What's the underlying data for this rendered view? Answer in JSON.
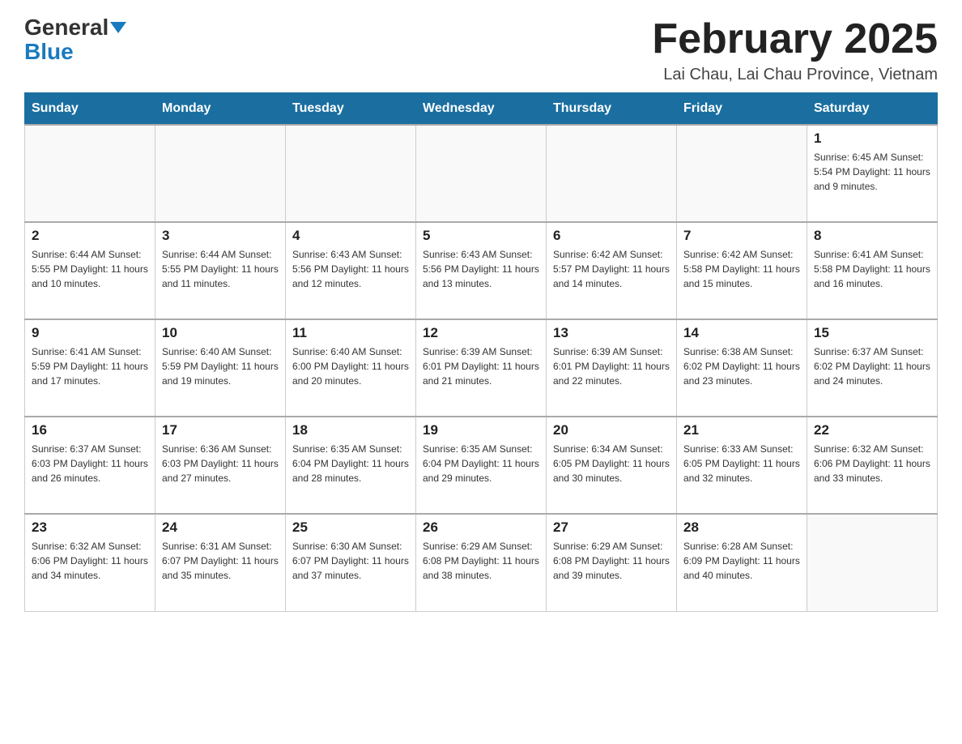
{
  "header": {
    "logo_general": "General",
    "logo_blue": "Blue",
    "month_title": "February 2025",
    "location": "Lai Chau, Lai Chau Province, Vietnam"
  },
  "days_of_week": [
    "Sunday",
    "Monday",
    "Tuesday",
    "Wednesday",
    "Thursday",
    "Friday",
    "Saturday"
  ],
  "weeks": [
    [
      {
        "day": "",
        "info": ""
      },
      {
        "day": "",
        "info": ""
      },
      {
        "day": "",
        "info": ""
      },
      {
        "day": "",
        "info": ""
      },
      {
        "day": "",
        "info": ""
      },
      {
        "day": "",
        "info": ""
      },
      {
        "day": "1",
        "info": "Sunrise: 6:45 AM\nSunset: 5:54 PM\nDaylight: 11 hours and 9 minutes."
      }
    ],
    [
      {
        "day": "2",
        "info": "Sunrise: 6:44 AM\nSunset: 5:55 PM\nDaylight: 11 hours and 10 minutes."
      },
      {
        "day": "3",
        "info": "Sunrise: 6:44 AM\nSunset: 5:55 PM\nDaylight: 11 hours and 11 minutes."
      },
      {
        "day": "4",
        "info": "Sunrise: 6:43 AM\nSunset: 5:56 PM\nDaylight: 11 hours and 12 minutes."
      },
      {
        "day": "5",
        "info": "Sunrise: 6:43 AM\nSunset: 5:56 PM\nDaylight: 11 hours and 13 minutes."
      },
      {
        "day": "6",
        "info": "Sunrise: 6:42 AM\nSunset: 5:57 PM\nDaylight: 11 hours and 14 minutes."
      },
      {
        "day": "7",
        "info": "Sunrise: 6:42 AM\nSunset: 5:58 PM\nDaylight: 11 hours and 15 minutes."
      },
      {
        "day": "8",
        "info": "Sunrise: 6:41 AM\nSunset: 5:58 PM\nDaylight: 11 hours and 16 minutes."
      }
    ],
    [
      {
        "day": "9",
        "info": "Sunrise: 6:41 AM\nSunset: 5:59 PM\nDaylight: 11 hours and 17 minutes."
      },
      {
        "day": "10",
        "info": "Sunrise: 6:40 AM\nSunset: 5:59 PM\nDaylight: 11 hours and 19 minutes."
      },
      {
        "day": "11",
        "info": "Sunrise: 6:40 AM\nSunset: 6:00 PM\nDaylight: 11 hours and 20 minutes."
      },
      {
        "day": "12",
        "info": "Sunrise: 6:39 AM\nSunset: 6:01 PM\nDaylight: 11 hours and 21 minutes."
      },
      {
        "day": "13",
        "info": "Sunrise: 6:39 AM\nSunset: 6:01 PM\nDaylight: 11 hours and 22 minutes."
      },
      {
        "day": "14",
        "info": "Sunrise: 6:38 AM\nSunset: 6:02 PM\nDaylight: 11 hours and 23 minutes."
      },
      {
        "day": "15",
        "info": "Sunrise: 6:37 AM\nSunset: 6:02 PM\nDaylight: 11 hours and 24 minutes."
      }
    ],
    [
      {
        "day": "16",
        "info": "Sunrise: 6:37 AM\nSunset: 6:03 PM\nDaylight: 11 hours and 26 minutes."
      },
      {
        "day": "17",
        "info": "Sunrise: 6:36 AM\nSunset: 6:03 PM\nDaylight: 11 hours and 27 minutes."
      },
      {
        "day": "18",
        "info": "Sunrise: 6:35 AM\nSunset: 6:04 PM\nDaylight: 11 hours and 28 minutes."
      },
      {
        "day": "19",
        "info": "Sunrise: 6:35 AM\nSunset: 6:04 PM\nDaylight: 11 hours and 29 minutes."
      },
      {
        "day": "20",
        "info": "Sunrise: 6:34 AM\nSunset: 6:05 PM\nDaylight: 11 hours and 30 minutes."
      },
      {
        "day": "21",
        "info": "Sunrise: 6:33 AM\nSunset: 6:05 PM\nDaylight: 11 hours and 32 minutes."
      },
      {
        "day": "22",
        "info": "Sunrise: 6:32 AM\nSunset: 6:06 PM\nDaylight: 11 hours and 33 minutes."
      }
    ],
    [
      {
        "day": "23",
        "info": "Sunrise: 6:32 AM\nSunset: 6:06 PM\nDaylight: 11 hours and 34 minutes."
      },
      {
        "day": "24",
        "info": "Sunrise: 6:31 AM\nSunset: 6:07 PM\nDaylight: 11 hours and 35 minutes."
      },
      {
        "day": "25",
        "info": "Sunrise: 6:30 AM\nSunset: 6:07 PM\nDaylight: 11 hours and 37 minutes."
      },
      {
        "day": "26",
        "info": "Sunrise: 6:29 AM\nSunset: 6:08 PM\nDaylight: 11 hours and 38 minutes."
      },
      {
        "day": "27",
        "info": "Sunrise: 6:29 AM\nSunset: 6:08 PM\nDaylight: 11 hours and 39 minutes."
      },
      {
        "day": "28",
        "info": "Sunrise: 6:28 AM\nSunset: 6:09 PM\nDaylight: 11 hours and 40 minutes."
      },
      {
        "day": "",
        "info": ""
      }
    ]
  ]
}
